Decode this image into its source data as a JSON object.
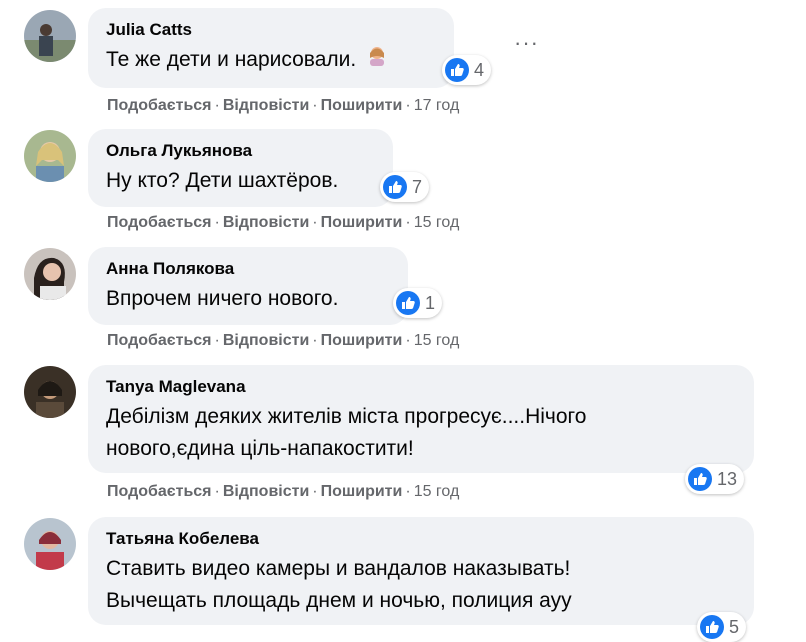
{
  "actions": {
    "like": "Подобається",
    "reply": "Відповісти",
    "share": "Поширити",
    "sep": "·"
  },
  "comments": [
    {
      "author": "Julia Catts",
      "text": "Те же дети и нарисовали.",
      "reactions": "4",
      "time": "17 год"
    },
    {
      "author": "Ольга Лукьянова",
      "text": "Ну кто? Дети шахтёров.",
      "reactions": "7",
      "time": "15 год"
    },
    {
      "author": "Анна Полякова",
      "text": "Впрочем ничего нового.",
      "reactions": "1",
      "time": "15 год"
    },
    {
      "author": "Tanya Maglevana",
      "text_line1": "Дебілізм деяких жителів міста прогресує....Нічого",
      "text_line2": "нового,єдина ціль-напакостити!",
      "reactions": "13",
      "time": "15 год"
    },
    {
      "author": "Татьяна Кобелева",
      "text_line1": "Ставить видео камеры и вандалов наказывать!",
      "text_line2": "Вычещать площадь днем и ночью, полиция ауу",
      "reactions": "5"
    }
  ],
  "icons": {
    "like": "thumbs-up-icon",
    "more": "more-options-icon",
    "emoji": "person-emoji-icon"
  },
  "colors": {
    "like_blue": "#1877f2",
    "bubble_bg": "#f0f2f5",
    "meta_gray": "#65676b"
  }
}
